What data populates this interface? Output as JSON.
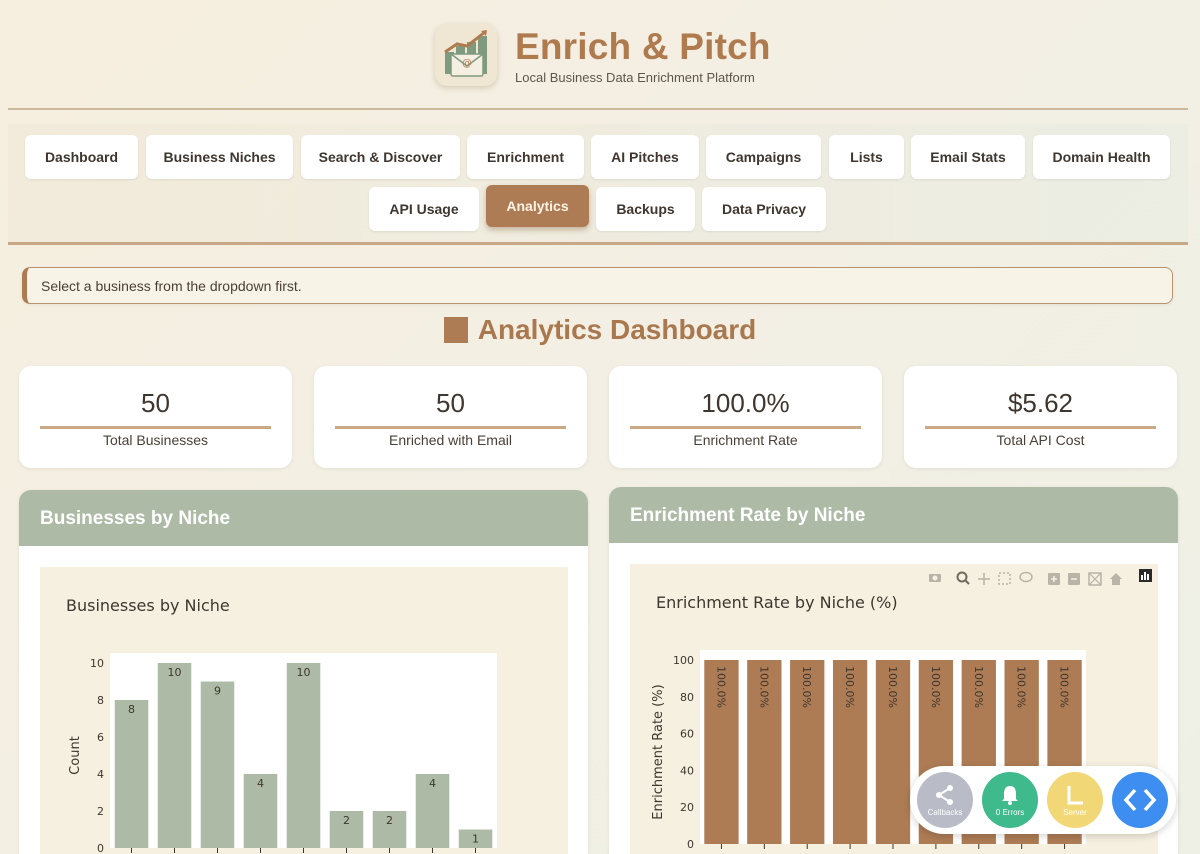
{
  "app": {
    "title": "Enrich & Pitch",
    "subtitle": "Local Business Data Enrichment Platform"
  },
  "tabs": [
    {
      "label": "Dashboard"
    },
    {
      "label": "Business Niches"
    },
    {
      "label": "Search & Discover"
    },
    {
      "label": "Enrichment"
    },
    {
      "label": "AI Pitches"
    },
    {
      "label": "Campaigns"
    },
    {
      "label": "Lists"
    },
    {
      "label": "Email Stats"
    },
    {
      "label": "Domain Health"
    },
    {
      "label": "API Usage"
    },
    {
      "label": "Analytics",
      "active": true
    },
    {
      "label": "Backups"
    },
    {
      "label": "Data Privacy"
    }
  ],
  "alert": {
    "text": "Select a business from the dropdown first."
  },
  "section": {
    "title": "Analytics Dashboard"
  },
  "stats": [
    {
      "value": "50",
      "label": "Total Businesses"
    },
    {
      "value": "50",
      "label": "Enriched with Email"
    },
    {
      "value": "100.0%",
      "label": "Enrichment Rate"
    },
    {
      "value": "$5.62",
      "label": "Total API Cost"
    }
  ],
  "panels": {
    "left": {
      "title": "Businesses by Niche"
    },
    "right": {
      "title": "Enrichment Rate by Niche"
    }
  },
  "chart_data": [
    {
      "type": "bar",
      "title": "Businesses by Niche",
      "ylabel": "Count",
      "xlabel": "",
      "values": [
        8,
        10,
        9,
        4,
        10,
        2,
        2,
        4,
        1
      ],
      "data_labels": [
        "8",
        "10",
        "9",
        "4",
        "10",
        "2",
        "2",
        "4",
        "1"
      ],
      "yticks": [
        "0",
        "2",
        "4",
        "6",
        "8",
        "10"
      ],
      "ylim": [
        0,
        10
      ],
      "grid": false,
      "color": "#adbba6"
    },
    {
      "type": "bar",
      "title": "Enrichment Rate by Niche (%)",
      "ylabel": "Enrichment Rate (%)",
      "xlabel": "",
      "values": [
        100,
        100,
        100,
        100,
        100,
        100,
        100,
        100,
        100
      ],
      "data_labels": [
        "100.0%",
        "100.0%",
        "100.0%",
        "100.0%",
        "100.0%",
        "100.0%",
        "100.0%",
        "100.0%",
        "100.0%"
      ],
      "yticks": [
        "0",
        "20",
        "40",
        "60",
        "80",
        "100"
      ],
      "ylim": [
        0,
        100
      ],
      "grid": false,
      "color": "#ad7c54"
    }
  ],
  "devtools": {
    "callbacks_label": "Callbacks",
    "errors_label": "0 Errors",
    "server_label": "Server"
  },
  "colors": {
    "accent": "#ad7c54",
    "sage": "#adbba6",
    "callbacks": "#b9bcc7",
    "errors": "#3fba8c",
    "server": "#f2d776",
    "code": "#3d8ef0"
  }
}
